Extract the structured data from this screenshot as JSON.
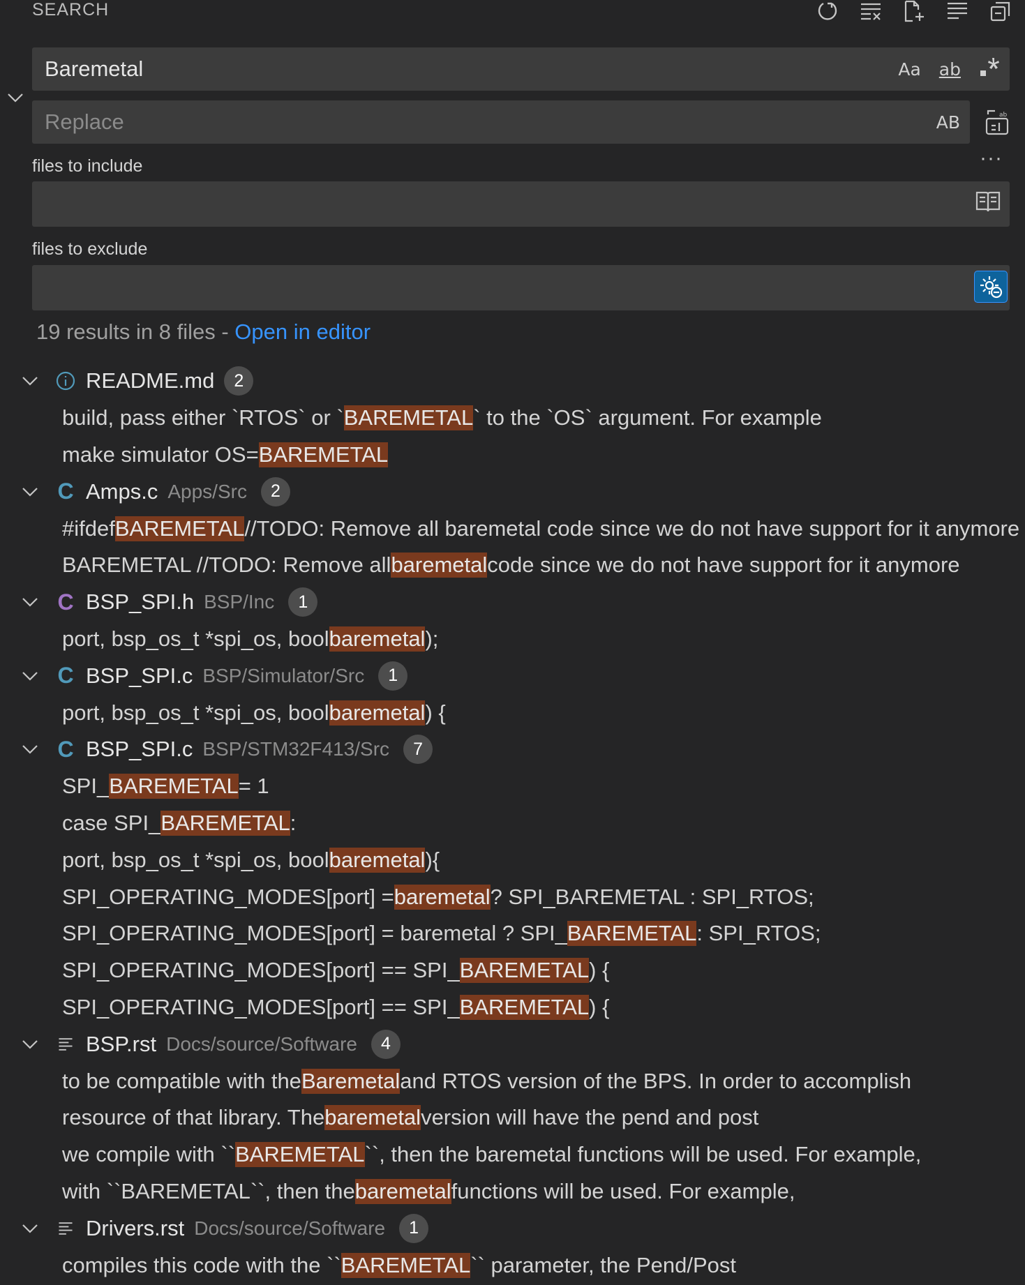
{
  "header": {
    "title": "SEARCH"
  },
  "toolbar": {
    "icons": [
      "refresh-icon",
      "clear-results-icon",
      "new-search-editor-icon",
      "view-as-tree-icon",
      "collapse-all-icon"
    ]
  },
  "search": {
    "value": "Baremetal",
    "options": {
      "match_case": "Aa",
      "whole_word": "ab",
      "regex": ".*"
    }
  },
  "replace": {
    "placeholder": "Replace",
    "preserve_case": "AB"
  },
  "include": {
    "label": "files to include",
    "value": ""
  },
  "exclude": {
    "label": "files to exclude",
    "value": ""
  },
  "more": "···",
  "summary": {
    "text": "19 results in 8 files - ",
    "link": "Open in editor"
  },
  "files": [
    {
      "name": "README.md",
      "path": "",
      "count": "2",
      "icon": "info-icon",
      "matches": [
        {
          "pre": "build, pass either `RTOS` or `",
          "hit": "BAREMETAL",
          "post": "` to the `OS` argument. For example"
        },
        {
          "pre": "make simulator OS=",
          "hit": "BAREMETAL",
          "post": ""
        }
      ]
    },
    {
      "name": "Amps.c",
      "path": "Apps/Src",
      "count": "2",
      "icon": "c-file-icon",
      "matches": [
        {
          "pre": "#ifdef ",
          "hit": "BAREMETAL",
          "post": " //TODO: Remove all baremetal code since we do not have support for it anymore"
        },
        {
          "pre": "BAREMETAL //TODO: Remove all ",
          "hit": "baremetal",
          "post": " code since we do not have support for it anymore"
        }
      ]
    },
    {
      "name": "BSP_SPI.h",
      "path": "BSP/Inc",
      "count": "1",
      "icon": "c-header-icon",
      "matches": [
        {
          "pre": "port, bsp_os_t *spi_os, bool ",
          "hit": "baremetal",
          "post": ");"
        }
      ]
    },
    {
      "name": "BSP_SPI.c",
      "path": "BSP/Simulator/Src",
      "count": "1",
      "icon": "c-file-icon",
      "matches": [
        {
          "pre": "port, bsp_os_t *spi_os, bool ",
          "hit": "baremetal",
          "post": ") {"
        }
      ]
    },
    {
      "name": "BSP_SPI.c",
      "path": "BSP/STM32F413/Src",
      "count": "7",
      "icon": "c-file-icon",
      "matches": [
        {
          "pre": "SPI_",
          "hit": "BAREMETAL",
          "post": " = 1"
        },
        {
          "pre": "case SPI_",
          "hit": "BAREMETAL",
          "post": ":"
        },
        {
          "pre": "port, bsp_os_t *spi_os, bool ",
          "hit": "baremetal",
          "post": "){"
        },
        {
          "pre": "SPI_OPERATING_MODES[port] = ",
          "hit": "baremetal",
          "post": " ? SPI_BAREMETAL : SPI_RTOS;"
        },
        {
          "pre": "SPI_OPERATING_MODES[port] = baremetal ? SPI_",
          "hit": "BAREMETAL",
          "post": " : SPI_RTOS;"
        },
        {
          "pre": "SPI_OPERATING_MODES[port] == SPI_",
          "hit": "BAREMETAL",
          "post": ") {"
        },
        {
          "pre": "SPI_OPERATING_MODES[port] == SPI_",
          "hit": "BAREMETAL",
          "post": ") {"
        }
      ]
    },
    {
      "name": "BSP.rst",
      "path": "Docs/source/Software",
      "count": "4",
      "icon": "text-file-icon",
      "matches": [
        {
          "pre": "to be compatible with the ",
          "hit": "Baremetal",
          "post": " and RTOS version of the BPS. In order to accomplish"
        },
        {
          "pre": "resource of that library. The ",
          "hit": "baremetal",
          "post": " version will have the pend and post"
        },
        {
          "pre": "we compile with ``",
          "hit": "BAREMETAL",
          "post": "``, then the baremetal functions will be used. For example,"
        },
        {
          "pre": "with ``BAREMETAL``, then the ",
          "hit": "baremetal",
          "post": " functions will be used. For example,"
        }
      ]
    },
    {
      "name": "Drivers.rst",
      "path": "Docs/source/Software",
      "count": "1",
      "icon": "text-file-icon",
      "matches": [
        {
          "pre": "compiles this code with the ``",
          "hit": "BAREMETAL",
          "post": "`` parameter, the Pend/Post"
        }
      ]
    }
  ]
}
